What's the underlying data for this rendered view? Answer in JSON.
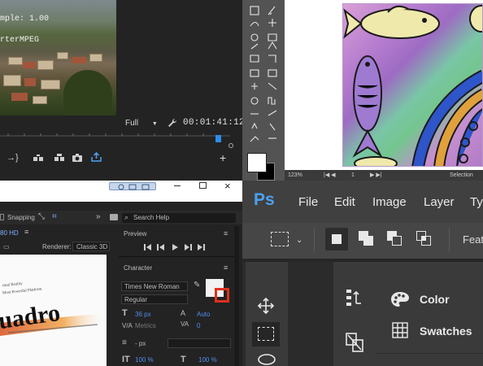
{
  "premiere": {
    "overlay_lines": [
      "mple: 1.00",
      "rterMPEG"
    ],
    "fit_dropdown": "Full",
    "timecode": "00:01:41:12"
  },
  "ps_canvas": {
    "zoom": "123%",
    "page": "1",
    "selection_label": "Selection"
  },
  "after_effects": {
    "snapping_label": "Snapping",
    "search_placeholder": "Search Help",
    "comp_label": "80 HD",
    "renderer_label": "Renderer:",
    "renderer_value": "Classic 3D",
    "preview_label": "Preview",
    "character_label": "Character",
    "font_family": "Times New Roman",
    "font_style": "Regular",
    "font_size": "36 px",
    "leading": "Auto",
    "kerning": "Metrics",
    "tracking": "0",
    "stroke_unit": "- px",
    "vscale": "100 %",
    "hscale": "100 %",
    "comp_text_big": "uadro",
    "comp_text_line1": "rtual Reality",
    "comp_text_line2": "Most Powerful Platform"
  },
  "photoshop": {
    "logo": "Ps",
    "menu": [
      "File",
      "Edit",
      "Image",
      "Layer",
      "Ty"
    ],
    "options_feat": "Feat",
    "panels": [
      "Color",
      "Swatches"
    ]
  },
  "colors": {
    "ps_blue": "#4ba2f2",
    "pr_playhead": "#2d8ceb",
    "ae_number_blue": "#4f8ff0"
  }
}
